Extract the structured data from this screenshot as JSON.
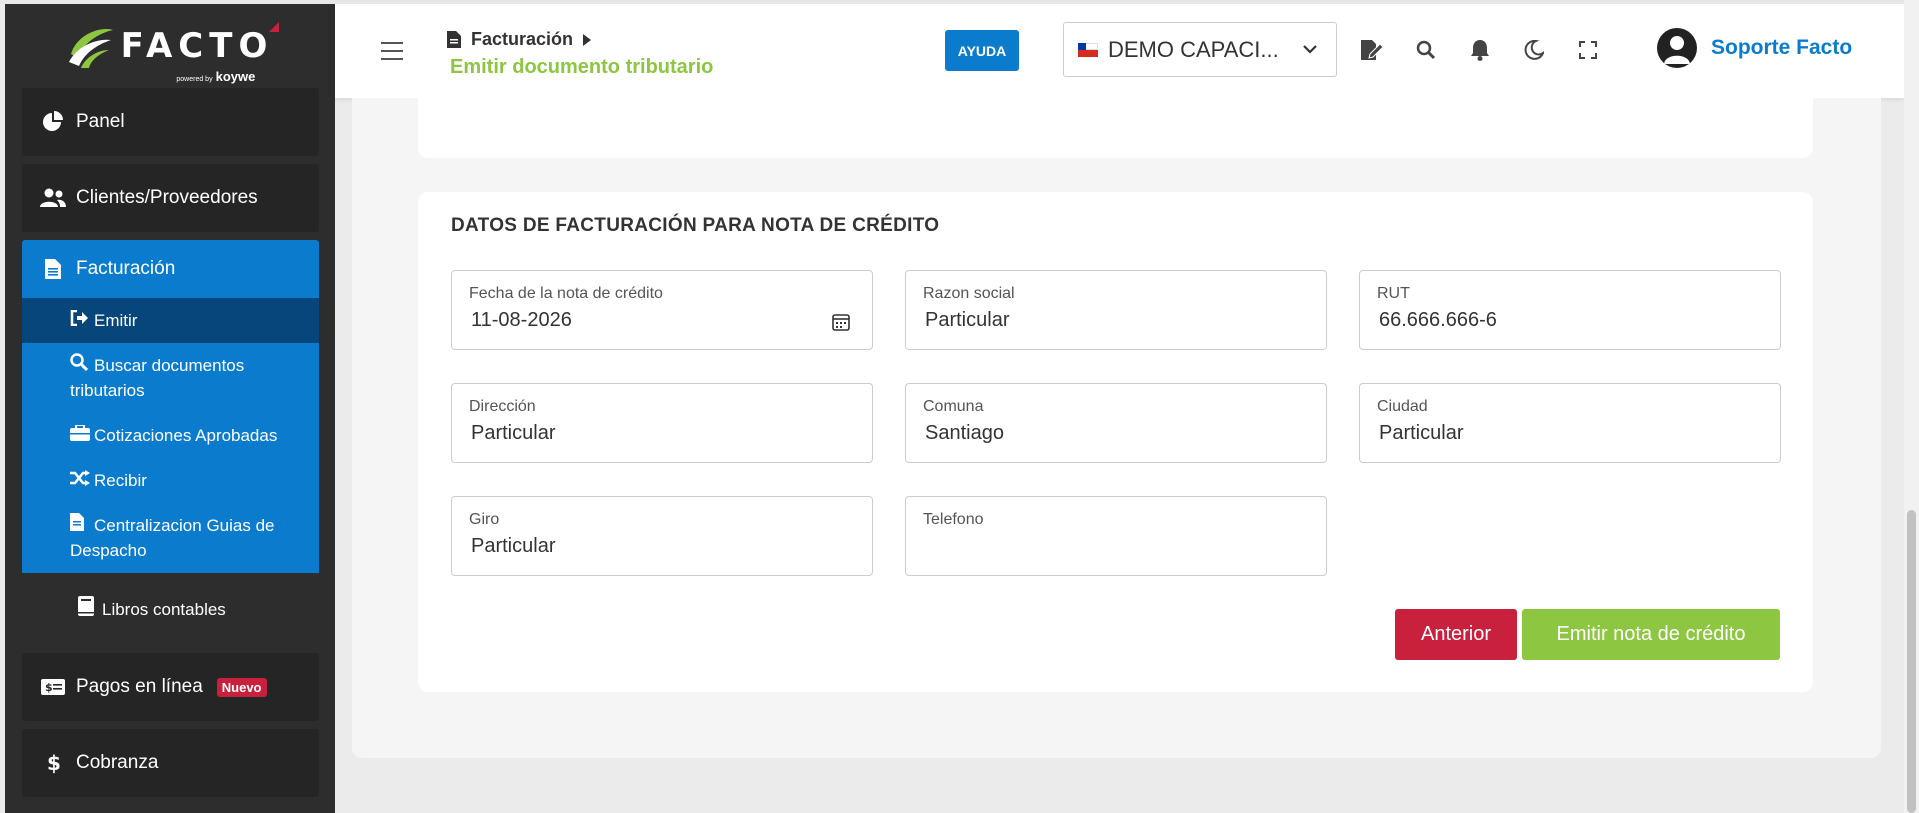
{
  "brand": {
    "name": "FACTO",
    "powered_prefix": "powered by",
    "powered_by": "koywe"
  },
  "sidebar": {
    "panel": "Panel",
    "clients": "Clientes/Proveedores",
    "billing": {
      "label": "Facturación",
      "items": [
        {
          "label": "Emitir"
        },
        {
          "label": "Buscar documentos tributarios"
        },
        {
          "label": "Cotizaciones Aprobadas"
        },
        {
          "label": "Recibir"
        },
        {
          "label": "Centralizacion Guias de Despacho"
        }
      ],
      "books": "Libros contables"
    },
    "payments": "Pagos en línea",
    "payments_badge": "Nuevo",
    "collections": "Cobranza"
  },
  "header": {
    "section": "Facturación",
    "page": "Emitir documento tributario",
    "help_label": "AYUDA",
    "company": "DEMO CAPACI...",
    "user": "Soporte Facto"
  },
  "form": {
    "title": "DATOS DE FACTURACIÓN PARA NOTA DE CRÉDITO",
    "fields": {
      "fecha": {
        "label": "Fecha de la nota de crédito",
        "value": "11-08-2026"
      },
      "razon": {
        "label": "Razon social",
        "value": "Particular"
      },
      "rut": {
        "label": "RUT",
        "value": "66.666.666-6"
      },
      "direccion": {
        "label": "Dirección",
        "value": "Particular"
      },
      "comuna": {
        "label": "Comuna",
        "value": "Santiago"
      },
      "ciudad": {
        "label": "Ciudad",
        "value": "Particular"
      },
      "giro": {
        "label": "Giro",
        "value": "Particular"
      },
      "telefono": {
        "label": "Telefono",
        "value": ""
      }
    },
    "prev_label": "Anterior",
    "submit_label": "Emitir nota de crédito"
  },
  "colors": {
    "primary": "#0b7ccd",
    "accent": "#8dc640",
    "danger": "#c8203d",
    "sidebar": "#2d2d2d"
  }
}
